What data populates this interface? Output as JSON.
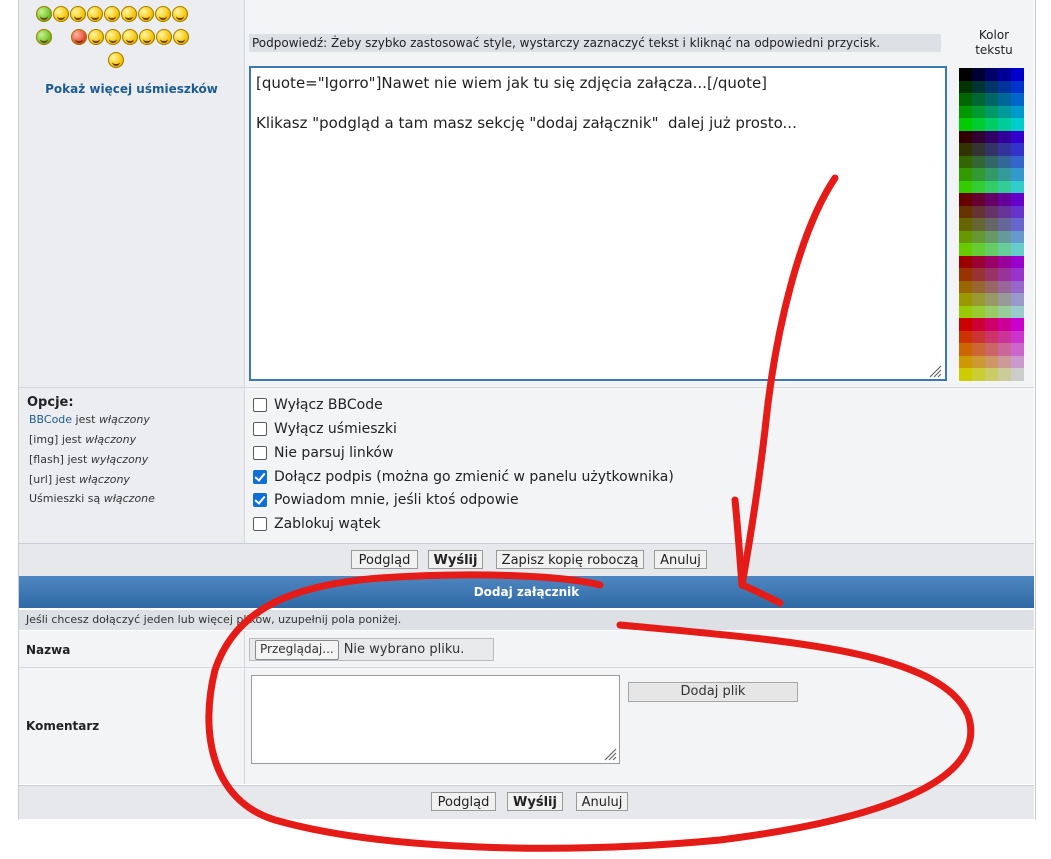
{
  "smileys": {
    "show_more": "Pokaż więcej uśmieszków"
  },
  "editor": {
    "hint": "Podpowiedź: Żeby szybko zastosować style, wystarczy zaznaczyć tekst i kliknąć na odpowiedni przycisk.",
    "text_color_label_1": "Kolor",
    "text_color_label_2": "tekstu",
    "content": "[quote=\"Igorro\"]Nawet nie wiem jak tu się zdjęcia załącza...[/quote]\n\nKlikasz \"podgląd a tam masz sekcję \"dodaj załącznik\"  dalej już prosto..."
  },
  "options": {
    "title": "Opcje:",
    "status": [
      {
        "name": "BBCode",
        "mid": " jest ",
        "value": "włączony"
      },
      {
        "name": "[img]",
        "mid": " jest ",
        "value": "włączony"
      },
      {
        "name": "[flash]",
        "mid": " jest ",
        "value": "wyłączony"
      },
      {
        "name": "[url]",
        "mid": " jest ",
        "value": "włączony"
      },
      {
        "name": "Uśmieszki",
        "mid": " są ",
        "value": "włączone"
      }
    ],
    "checkboxes": [
      {
        "label": "Wyłącz BBCode",
        "checked": false
      },
      {
        "label": "Wyłącz uśmieszki",
        "checked": false
      },
      {
        "label": "Nie parsuj linków",
        "checked": false
      },
      {
        "label": "Dołącz podpis (można go zmienić w panelu użytkownika)",
        "checked": true
      },
      {
        "label": "Powiadom mnie, jeśli ktoś odpowie",
        "checked": true
      },
      {
        "label": "Zablokuj wątek",
        "checked": false
      }
    ]
  },
  "buttons": {
    "preview": "Podgląd",
    "submit": "Wyślij",
    "save_draft": "Zapisz kopię roboczą",
    "cancel": "Anuluj"
  },
  "attachment": {
    "header": "Dodaj załącznik",
    "info": "Jeśli chcesz dołączyć jeden lub więcej plików, uzupełnij pola poniżej.",
    "name_label": "Nazwa",
    "browse": "Przeglądaj...",
    "no_file": "Nie wybrano pliku.",
    "comment_label": "Komentarz",
    "add_file": "Dodaj plik"
  },
  "colors": {
    "accent": "#2f6aa6",
    "annotation": "#e41b17"
  }
}
